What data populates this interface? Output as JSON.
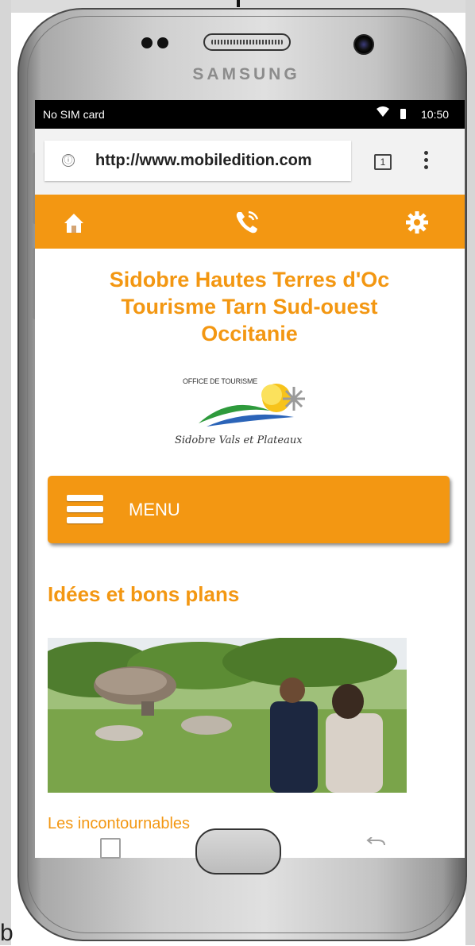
{
  "device": {
    "brand": "SAMSUNG"
  },
  "statusbar": {
    "carrier": "No SIM card",
    "time": "10:50",
    "wifi_icon": "wifi-icon",
    "battery_icon": "battery-icon"
  },
  "browser": {
    "url": "http://www.mobiledition.com",
    "info_icon": "ⓘ",
    "tab_count": "1"
  },
  "navbar": {
    "color": "#f39712",
    "items": [
      "home-icon",
      "phone-icon",
      "gear-icon"
    ]
  },
  "page": {
    "title_lines": [
      "Sidobre Hautes Terres d'Oc",
      "Tourisme Tarn Sud-ouest",
      "Occitanie"
    ],
    "logo": {
      "top_text": "OFFICE DE TOURISME",
      "script_text": "Sidobre Vals et Plateaux"
    },
    "menu_label": "MENU",
    "section_title": "Idées et bons plans",
    "photo_caption": "Les incontournables"
  },
  "page_corner_char": "b"
}
